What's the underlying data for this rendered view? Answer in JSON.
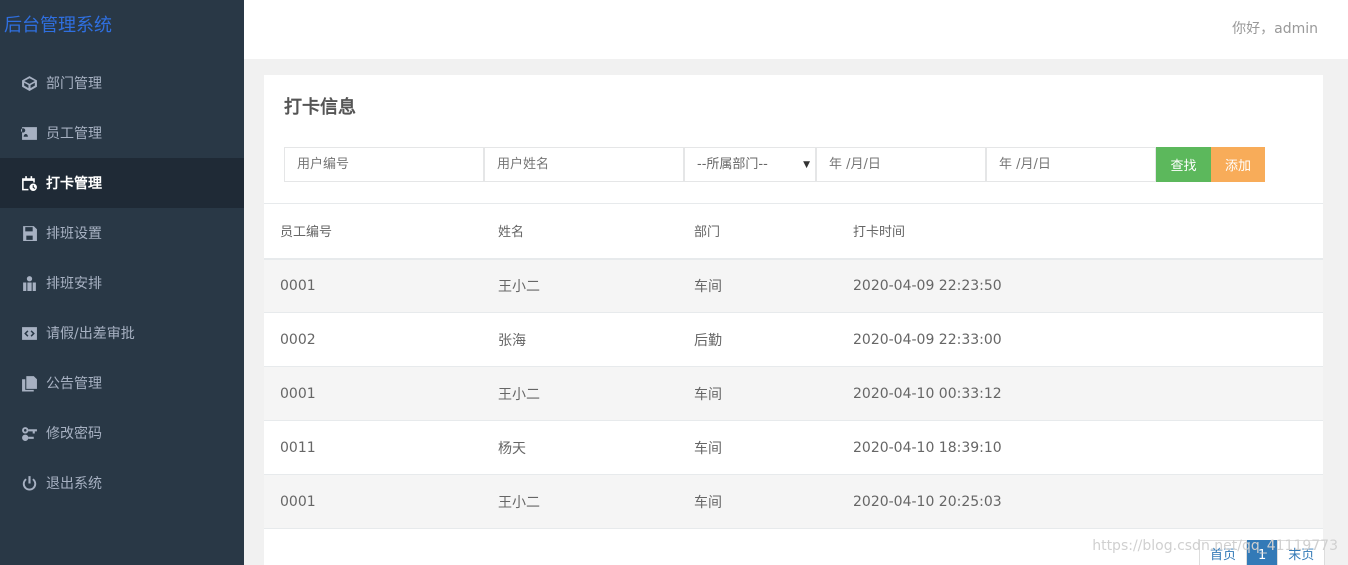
{
  "app": {
    "brand": "后台管理系统"
  },
  "header": {
    "greeting": "你好，admin"
  },
  "sidebar": {
    "items": [
      {
        "label": "部门管理",
        "icon": "cube-icon"
      },
      {
        "label": "员工管理",
        "icon": "id-card-icon"
      },
      {
        "label": "打卡管理",
        "icon": "clock-calendar-icon"
      },
      {
        "label": "排班设置",
        "icon": "save-icon"
      },
      {
        "label": "排班安排",
        "icon": "user-shift-icon"
      },
      {
        "label": "请假/出差审批",
        "icon": "code-icon"
      },
      {
        "label": "公告管理",
        "icon": "files-icon"
      },
      {
        "label": "修改密码",
        "icon": "key-icon"
      },
      {
        "label": "退出系统",
        "icon": "power-icon"
      }
    ],
    "active_index": 2
  },
  "panel": {
    "title": "打卡信息"
  },
  "filters": {
    "id_placeholder": "用户编号",
    "name_placeholder": "用户姓名",
    "dept_selected": "--所属部门--",
    "date_start": "年 /月/日",
    "date_end": "年 /月/日",
    "search_label": "查找",
    "add_label": "添加"
  },
  "table": {
    "headers": [
      "员工编号",
      "姓名",
      "部门",
      "打卡时间"
    ],
    "rows": [
      [
        "0001",
        "王小二",
        "车间",
        "2020-04-09 22:23:50"
      ],
      [
        "0002",
        "张海",
        "后勤",
        "2020-04-09 22:33:00"
      ],
      [
        "0001",
        "王小二",
        "车间",
        "2020-04-10 00:33:12"
      ],
      [
        "0011",
        "杨天",
        "车间",
        "2020-04-10 18:39:10"
      ],
      [
        "0001",
        "王小二",
        "车间",
        "2020-04-10 20:25:03"
      ]
    ]
  },
  "pager": {
    "first": "首页",
    "current": "1",
    "last": "末页"
  },
  "watermark": "https://blog.csdn.net/qq_41119773",
  "colors": {
    "sidebar": "#293846",
    "brand": "#2f6fe0",
    "search": "#5cb85c",
    "add": "#f8ac59",
    "accent": "#337ab7"
  }
}
